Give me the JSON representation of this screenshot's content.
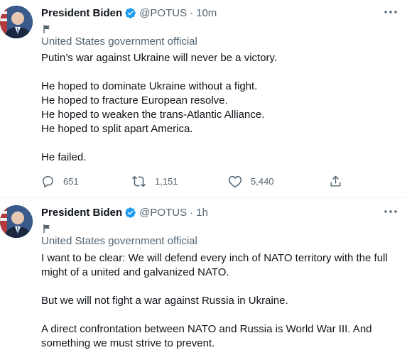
{
  "tweets": [
    {
      "author_name": "President Biden",
      "handle": "@POTUS",
      "separator": "·",
      "time": "10m",
      "label": "United States government official",
      "paragraphs": [
        "Putin’s war against Ukraine will never be a victory.",
        "He hoped to dominate Ukraine without a fight.\nHe hoped to fracture European resolve.\nHe hoped to weaken the trans-Atlantic Alliance.\nHe hoped to split apart America.",
        "He failed."
      ],
      "replies": "651",
      "retweets": "1,151",
      "likes": "5,440"
    },
    {
      "author_name": "President Biden",
      "handle": "@POTUS",
      "separator": "·",
      "time": "1h",
      "label": "United States government official",
      "paragraphs": [
        "I want to be clear: We will defend every inch of NATO territory with the full might of a united and galvanized NATO.",
        "But we will not fight a war against Russia in Ukraine.",
        "A direct confrontation between NATO and Russia is World War III. And something we must strive to prevent."
      ]
    }
  ],
  "colors": {
    "verified": "#1d9bf0",
    "secondary_text": "#536471",
    "primary_text": "#0f1419"
  },
  "icons": [
    "verified-badge-icon",
    "more-icon",
    "flag-icon",
    "reply-icon",
    "retweet-icon",
    "like-icon",
    "share-icon"
  ]
}
